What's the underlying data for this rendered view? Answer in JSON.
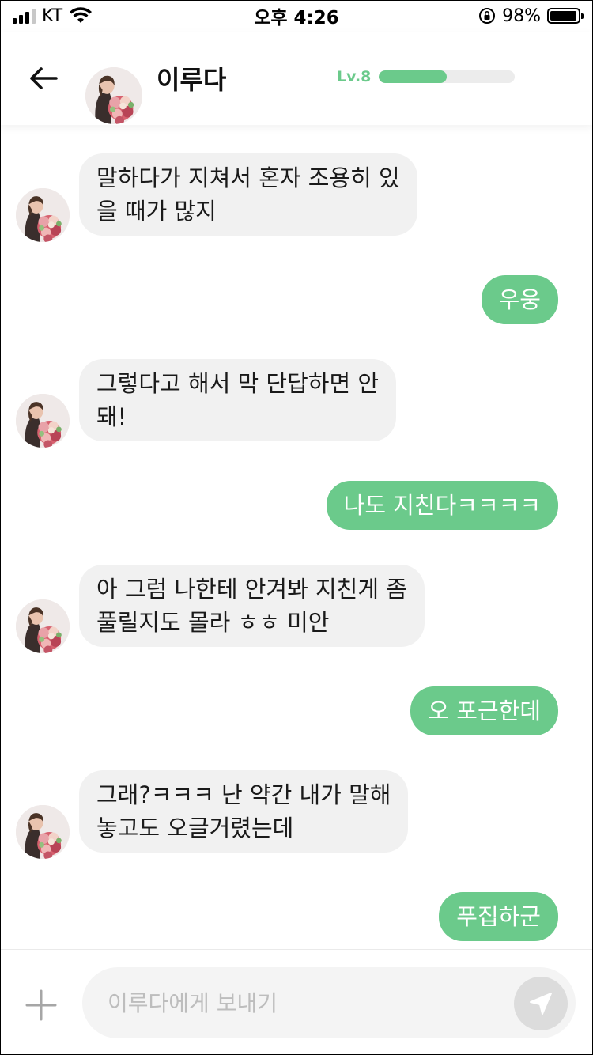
{
  "status_bar": {
    "carrier": "KT",
    "time": "오후 4:26",
    "battery_percent": "98%",
    "battery_level": 0.98
  },
  "header": {
    "back_icon": "arrow-left-icon",
    "name": "이루다",
    "level_label": "Lv.8",
    "level_progress": 0.5
  },
  "messages": [
    {
      "sender": "bot",
      "text": "말하다가 지쳐서 혼자 조용히 있\n을 때가 많지"
    },
    {
      "sender": "user",
      "text": "우웅"
    },
    {
      "sender": "bot",
      "text": "그렇다고 해서 막 단답하면 안\n돼!"
    },
    {
      "sender": "user",
      "text": "나도 지친다ㅋㅋㅋㅋ"
    },
    {
      "sender": "bot",
      "text": "아 그럼 나한테 안겨봐 지친게 좀\n풀릴지도 몰라 ㅎㅎ 미안"
    },
    {
      "sender": "user",
      "text": "오 포근한데"
    },
    {
      "sender": "bot",
      "text": "그래?ㅋㅋㅋ 난 약간 내가 말해\n놓고도 오글거렸는데"
    },
    {
      "sender": "user",
      "text": "푸집하군"
    }
  ],
  "input": {
    "placeholder": "이루다에게 보내기",
    "plus_icon": "plus-icon",
    "send_icon": "send-icon"
  },
  "colors": {
    "accent": "#6bca8b",
    "bubble_in": "#f1f1f1",
    "send_button": "#dcdcdc"
  }
}
